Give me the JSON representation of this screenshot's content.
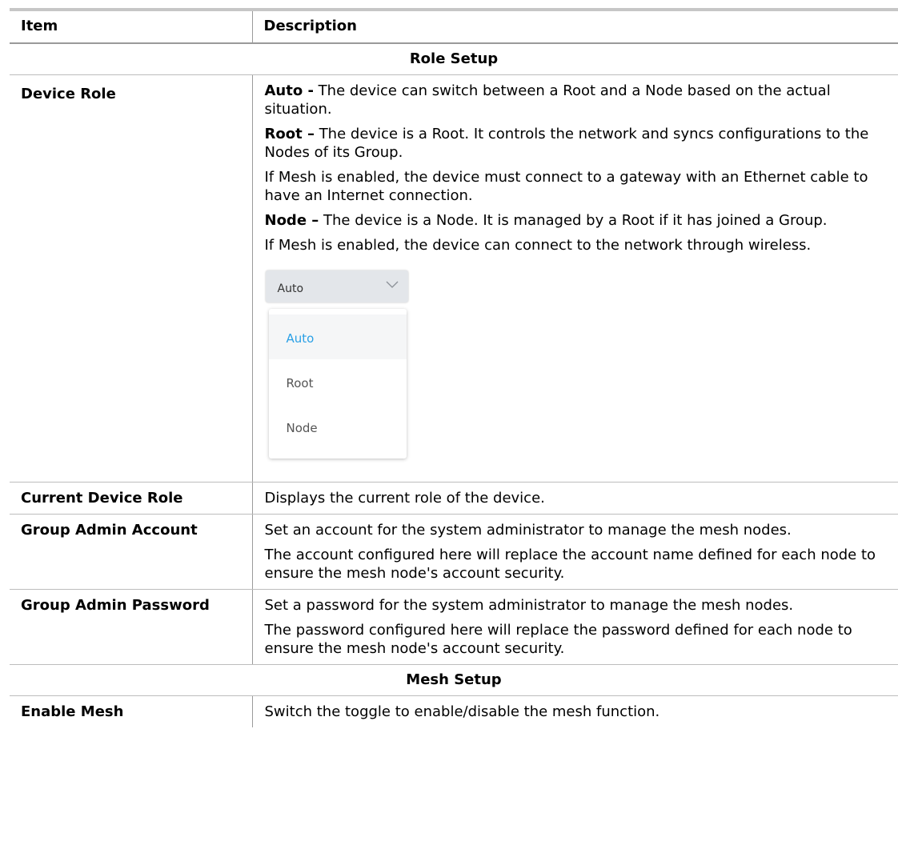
{
  "table": {
    "header": {
      "item": "Item",
      "description": "Description"
    },
    "sections": {
      "role_setup": "Role Setup",
      "mesh_setup": "Mesh Setup"
    },
    "rows": {
      "device_role": {
        "name": "Device Role",
        "auto_term": "Auto -",
        "auto_text": " The device can switch between a Root and a Node based on the actual situation.",
        "root_term": "Root –",
        "root_text": " The device is a Root. It controls the network and syncs configurations to the Nodes of its Group.",
        "root_note": "If Mesh is enabled, the device must connect to a gateway with an Ethernet cable to have an Internet connection.",
        "node_term": "Node –",
        "node_text": " The device is a Node. It is managed by a Root if it has joined a Group.",
        "node_note": "If Mesh is enabled, the device can connect to the network through wireless.",
        "dropdown": {
          "selected": "Auto",
          "options": [
            "Auto",
            "Root",
            "Node"
          ],
          "highlight_color": "#2aa0e6",
          "chevron_icon": "chevron-down-icon"
        }
      },
      "current_device_role": {
        "name": "Current Device Role",
        "desc": "Displays the current role of the device."
      },
      "group_admin_account": {
        "name": "Group Admin Account",
        "desc1": "Set an account for the system administrator to manage the mesh nodes.",
        "desc2": "The account configured here will replace the account name defined for each node to ensure the mesh node's account security."
      },
      "group_admin_password": {
        "name": "Group Admin Password",
        "desc1": "Set a password for the system administrator to manage the mesh nodes.",
        "desc2": "The password configured here will replace the password defined for each node to ensure the mesh node's account security."
      },
      "enable_mesh": {
        "name": "Enable Mesh",
        "desc": "Switch the toggle to enable/disable the mesh function."
      }
    }
  }
}
